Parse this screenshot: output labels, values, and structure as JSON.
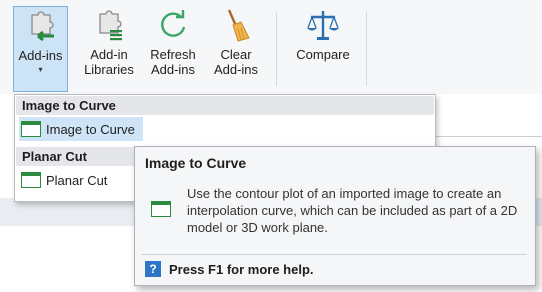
{
  "ribbon": {
    "buttons": [
      {
        "line1": "Add-ins",
        "line2": "",
        "caret": "▾",
        "icon": "puzzle-arrow-icon"
      },
      {
        "line1": "Add-in",
        "line2": "Libraries",
        "icon": "puzzle-list-icon"
      },
      {
        "line1": "Refresh",
        "line2": "Add-ins",
        "icon": "refresh-icon"
      },
      {
        "line1": "Clear",
        "line2": "Add-ins",
        "icon": "broom-icon"
      },
      {
        "line1": "Compare",
        "line2": "",
        "icon": "scales-icon"
      }
    ]
  },
  "menu": {
    "sections": [
      {
        "header": "Image to Curve",
        "item": "Image to Curve"
      },
      {
        "header": "Planar Cut",
        "item": "Planar Cut"
      }
    ]
  },
  "tooltip": {
    "title": "Image to Curve",
    "description": "Use the contour plot of an imported image to create an interpolation curve, which can be included as part of a 2D model or 3D work plane.",
    "help_icon": "?",
    "help": "Press F1 for more help."
  },
  "colors": {
    "accent_green": "#2b8a3e",
    "refresh_green": "#3aa66a",
    "help_blue": "#2f75c7",
    "selected_bg": "#cde3f6"
  }
}
